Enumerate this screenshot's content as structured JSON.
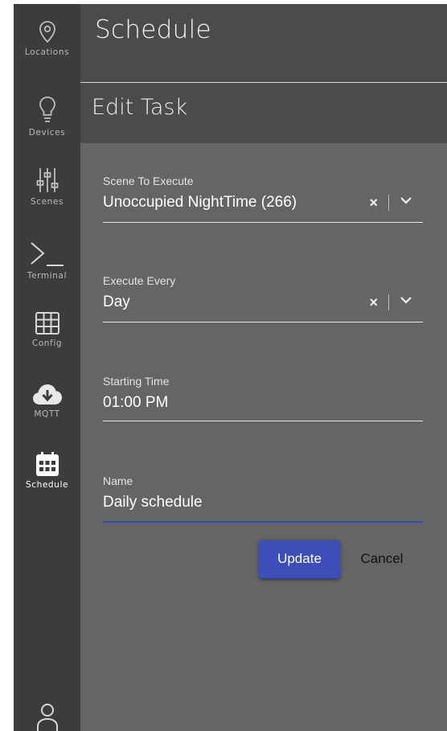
{
  "sidebar": {
    "items": [
      {
        "label": "Locations",
        "icon": "map-pin-icon"
      },
      {
        "label": "Devices",
        "icon": "lightbulb-icon"
      },
      {
        "label": "Scenes",
        "icon": "sliders-icon"
      },
      {
        "label": "Terminal",
        "icon": "terminal-icon"
      },
      {
        "label": "Config",
        "icon": "grid-icon"
      },
      {
        "label": "MQTT",
        "icon": "cloud-download-icon"
      },
      {
        "label": "Schedule",
        "icon": "calendar-icon"
      }
    ],
    "active": "Schedule",
    "user_icon": "user-icon"
  },
  "header": {
    "title": "Schedule"
  },
  "subheader": {
    "title": "Edit Task"
  },
  "form": {
    "scene": {
      "label": "Scene To Execute",
      "value": "Unoccupied NightTime (266)",
      "clear": "×"
    },
    "every": {
      "label": "Execute Every",
      "value": "Day",
      "clear": "×"
    },
    "start": {
      "label": "Starting Time",
      "value": "01:00 PM"
    },
    "name": {
      "label": "Name",
      "value": "Daily schedule"
    }
  },
  "actions": {
    "update": "Update",
    "cancel": "Cancel"
  },
  "colors": {
    "accent": "#3d4dba",
    "sidebar": "#3c3c3c",
    "panel": "#656565",
    "header": "#4b4b4b"
  }
}
